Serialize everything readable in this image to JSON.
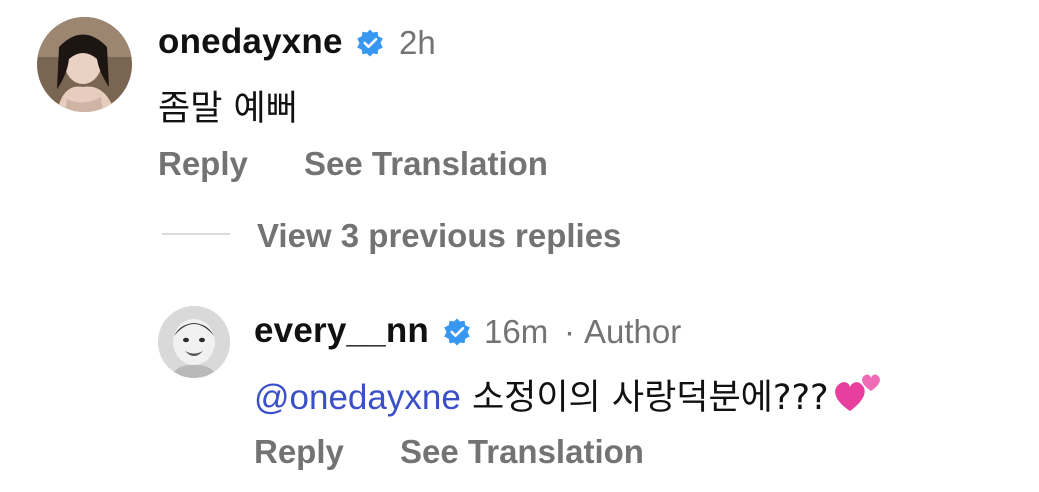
{
  "comment": {
    "username": "onedayxne",
    "time": "2h",
    "text": "좀말 예뻐",
    "actions": {
      "reply": "Reply",
      "translate": "See Translation"
    }
  },
  "view_replies": {
    "label": "View 3 previous replies"
  },
  "reply": {
    "username": "every__nn",
    "time": "16m",
    "separator": "·",
    "author_badge": "Author",
    "mention": "@onedayxne",
    "text": "소정이의 사랑덕분에???",
    "emoji": "two-hearts-icon",
    "actions": {
      "reply": "Reply",
      "translate": "See Translation"
    }
  },
  "colors": {
    "verified": "#3897f0",
    "mention": "#3b4fc9",
    "secondary_text": "#737373",
    "heart": "#e83e9e"
  }
}
